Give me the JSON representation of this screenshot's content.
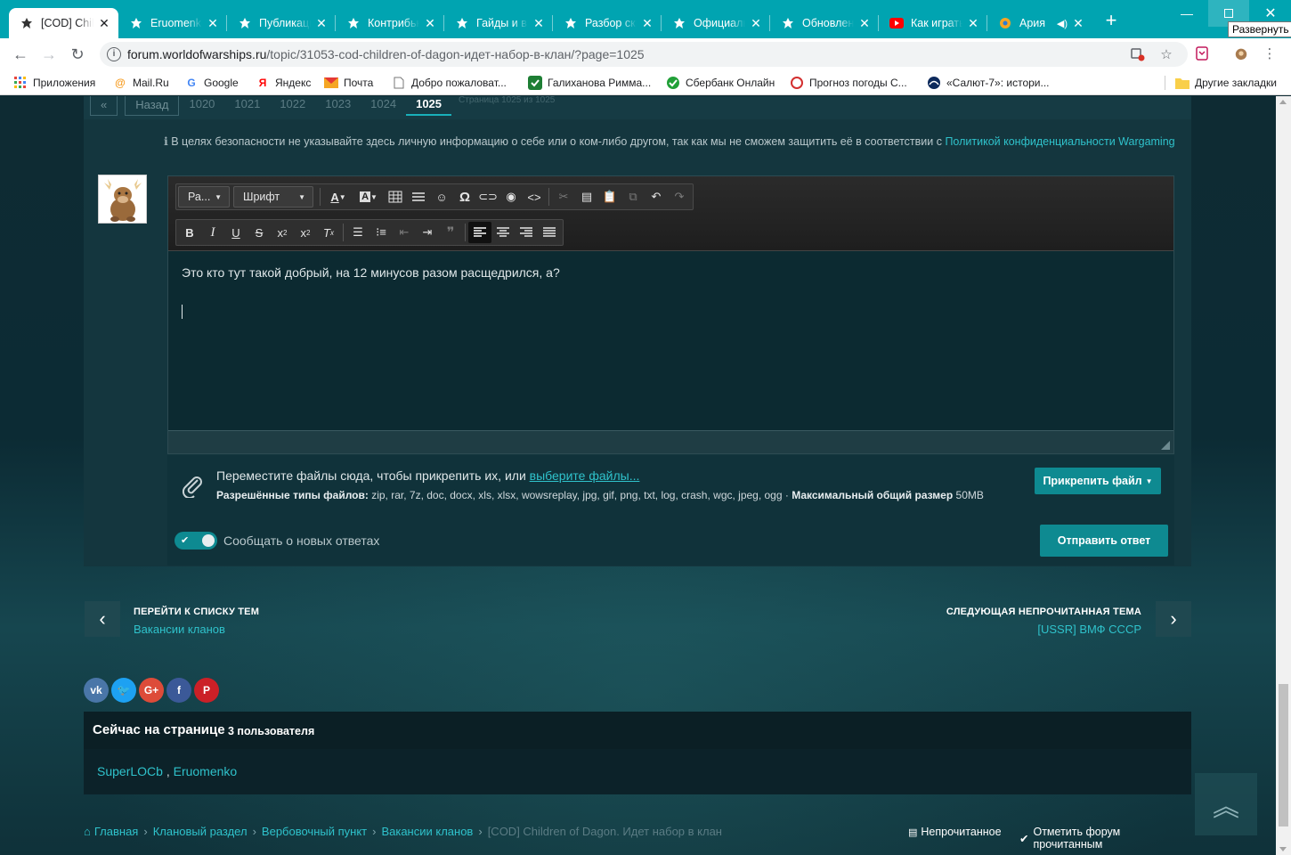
{
  "browser": {
    "tabs": [
      {
        "title": "[COD] Children of Dagon",
        "icon": "wows-icon",
        "active": true
      },
      {
        "title": "Eruomenko",
        "icon": "wows-icon"
      },
      {
        "title": "Публикации",
        "icon": "wows-icon"
      },
      {
        "title": "Контрибьюторы",
        "icon": "wows-icon"
      },
      {
        "title": "Гайды и видео",
        "icon": "wows-icon"
      },
      {
        "title": "Разбор скриншотов",
        "icon": "wows-icon"
      },
      {
        "title": "Официальный",
        "icon": "wows-icon"
      },
      {
        "title": "Обновления",
        "icon": "wows-icon"
      },
      {
        "title": "Как играть",
        "icon": "youtube-icon"
      },
      {
        "title": "Ария",
        "icon": "audio-icon"
      }
    ],
    "tooltip": "Развернуть",
    "url_host": "forum.worldofwarships.ru",
    "url_path": "/topic/31053-cod-children-of-dagon-идет-набор-в-клан/?page=1025",
    "bookmarks": [
      {
        "label": "Приложения",
        "icon": "apps-grid-icon"
      },
      {
        "label": "Mail.Ru",
        "icon": "mailru-icon"
      },
      {
        "label": "Google",
        "icon": "google-icon"
      },
      {
        "label": "Яндекс",
        "icon": "yandex-icon"
      },
      {
        "label": "Почта",
        "icon": "mail-icon"
      },
      {
        "label": "Добро пожаловат...",
        "icon": "page-icon"
      },
      {
        "label": "Галиханова Римма...",
        "icon": "check-icon"
      },
      {
        "label": "Сбербанк Онлайн",
        "icon": "sber-icon"
      },
      {
        "label": "Прогноз погоды С...",
        "icon": "weather-icon"
      },
      {
        "label": "«Салют-7»: истори...",
        "icon": "salut-icon"
      }
    ],
    "other_bookmarks": "Другие закладки"
  },
  "pager": {
    "back": "Назад",
    "pages": [
      "1020",
      "1021",
      "1022",
      "1023",
      "1024",
      "1025"
    ],
    "current": "1025",
    "info": "Страница 1025 из 1025"
  },
  "notice": {
    "text": "В целях безопасности не указывайте здесь личную информацию о себе или о ком-либо другом, так как мы не сможем защитить её в соответствии с ",
    "link": "Политикой конфиденциальности Wargaming"
  },
  "editor": {
    "format_combo": "Ра...",
    "font_combo": "Шрифт",
    "content": "Это кто тут такой добрый, на 12 минусов разом расщедрился, а?"
  },
  "attach": {
    "line1_text": "Переместите файлы сюда, чтобы прикрепить их, или ",
    "line1_link": "выберите файлы...",
    "types_label": "Разрешённые типы файлов:",
    "types": "zip, rar, 7z, doc, docx, xls, xlsx, wowsreplay, jpg, gif, png, txt, log, crash, wgc, jpeg, ogg",
    "size_label": "Максимальный общий размер",
    "size": "50MB",
    "button": "Прикрепить файл"
  },
  "options": {
    "notify_label": "Сообщать о новых ответах",
    "submit": "Отправить ответ"
  },
  "nav": {
    "prev_title": "ПЕРЕЙТИ К СПИСКУ ТЕМ",
    "prev_link": "Вакансии кланов",
    "next_title": "СЛЕДУЮЩАЯ НЕПРОЧИТАННАЯ ТЕМА",
    "next_link": "[USSR] ВМФ СССР"
  },
  "online": {
    "title": "Сейчас на странице",
    "count": "3 пользователя",
    "users": [
      "SuperLOCb",
      "Eruomenko"
    ]
  },
  "breadcrumbs": {
    "items": [
      "Главная",
      "Клановый раздел",
      "Вербовочный пункт",
      "Вакансии кланов"
    ],
    "current": "[COD] Children of Dagon. Идет набор в клан",
    "unread": "Непрочитанное",
    "mark_read": "Отметить форум прочитанным"
  },
  "colors": {
    "accent": "#00a4b1",
    "teal_button": "#0e8a91",
    "link": "#2fc2cb"
  }
}
